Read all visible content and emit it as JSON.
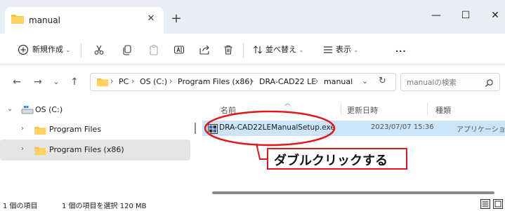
{
  "window": {
    "tab_title": "manual",
    "tab_close": "✕",
    "new_tab": "+",
    "minimize": "—",
    "maximize": "☐",
    "close": "✕"
  },
  "toolbar": {
    "new_label": "新規作成",
    "sort_label": "並べ替え",
    "view_label": "表示",
    "more_label": "..."
  },
  "address": {
    "crumbs": [
      "PC",
      "OS (C:)",
      "Program Files (x86)",
      "DRA-CAD22 LE",
      "manual"
    ],
    "separator": "›",
    "search_placeholder": "manualの検索"
  },
  "nav_pane": {
    "items": [
      {
        "label": "OS (C:)",
        "expanded": true
      },
      {
        "label": "Program Files",
        "expanded": false
      },
      {
        "label": "Program Files (x86)",
        "expanded": false,
        "selected": true
      }
    ]
  },
  "file_list": {
    "columns": {
      "name": "名前",
      "date": "更新日時",
      "type": "種類"
    },
    "rows": [
      {
        "name": "DRA-CAD22LEManualSetup.exe",
        "modified": "2023/07/07 15:36",
        "type": "アプリケーション",
        "selected": true
      }
    ]
  },
  "annotation": {
    "callout_text": "ダブルクリックする",
    "accent_color": "#e3161b"
  },
  "status_bar": {
    "item_count": "1 個の項目",
    "selection": "1 個の項目を選択  120 MB"
  },
  "colors": {
    "titlebar": "#e9eef6",
    "selection": "#cce4f7",
    "folder": "#f5c242"
  }
}
